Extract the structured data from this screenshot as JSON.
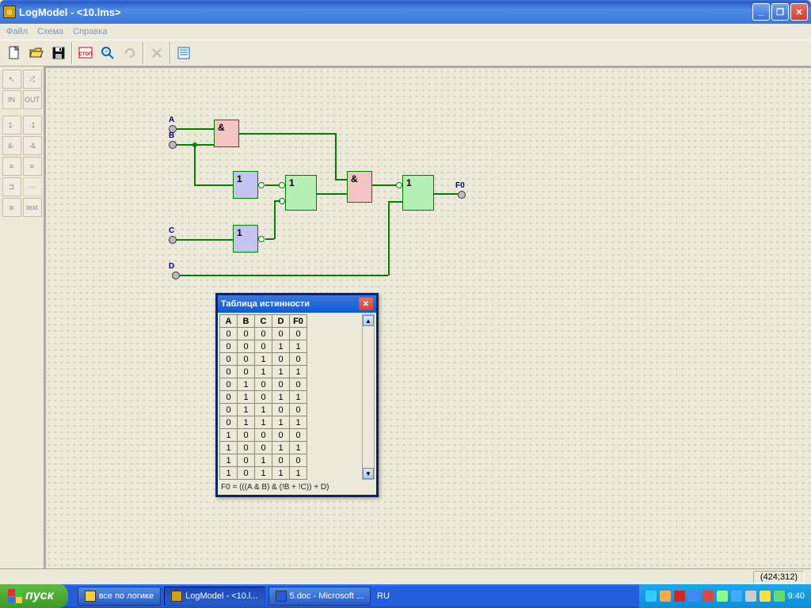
{
  "window": {
    "title": "LogModel - <10.lms>",
    "min_tooltip": "Minimize",
    "max_tooltip": "Restore",
    "close_tooltip": "Close"
  },
  "menu": {
    "file": "Файл",
    "schema": "Схема",
    "help": "Справка"
  },
  "toolbar": {
    "new": "New",
    "open": "Open",
    "save": "Save",
    "stop": "СТОП",
    "zoom": "Zoom",
    "refresh": "Refresh",
    "delete": "Delete",
    "list": "List"
  },
  "palette": {
    "arrow": "↖",
    "move": "⤪",
    "in": "IN",
    "out": "OUT",
    "one_l": "1·",
    "one_r": "·1",
    "and_l": "&·",
    "and_r": "·&",
    "m1": "≡1",
    "m2": "≡",
    "m3": "1̵",
    "m4": "—",
    "seg": "⧈",
    "text": "text"
  },
  "circuit": {
    "inputs": {
      "A": "A",
      "B": "B",
      "C": "C",
      "D": "D"
    },
    "output": "F0",
    "gates": {
      "and1": "&",
      "not1": "1",
      "not2": "1",
      "or1": "1",
      "and2": "&",
      "or2": "1"
    }
  },
  "truth_table": {
    "title": "Таблица истинности",
    "columns": [
      "A",
      "B",
      "C",
      "D",
      "F0"
    ],
    "rows": [
      [
        0,
        0,
        0,
        0,
        0
      ],
      [
        0,
        0,
        0,
        1,
        1
      ],
      [
        0,
        0,
        1,
        0,
        0
      ],
      [
        0,
        0,
        1,
        1,
        1
      ],
      [
        0,
        1,
        0,
        0,
        0
      ],
      [
        0,
        1,
        0,
        1,
        1
      ],
      [
        0,
        1,
        1,
        0,
        0
      ],
      [
        0,
        1,
        1,
        1,
        1
      ],
      [
        1,
        0,
        0,
        0,
        0
      ],
      [
        1,
        0,
        0,
        1,
        1
      ],
      [
        1,
        0,
        1,
        0,
        0
      ],
      [
        1,
        0,
        1,
        1,
        1
      ]
    ],
    "formula": "F0 = (((A & B) & (!B + !C)) + D)"
  },
  "statusbar": {
    "coords": "(424;312)"
  },
  "taskbar": {
    "start": "пуск",
    "tasks": [
      {
        "label": "все по логике"
      },
      {
        "label": "LogModel - <10.l..."
      },
      {
        "label": "5.doc - Microsoft ..."
      }
    ],
    "lang": "RU",
    "clock": "9:40"
  }
}
